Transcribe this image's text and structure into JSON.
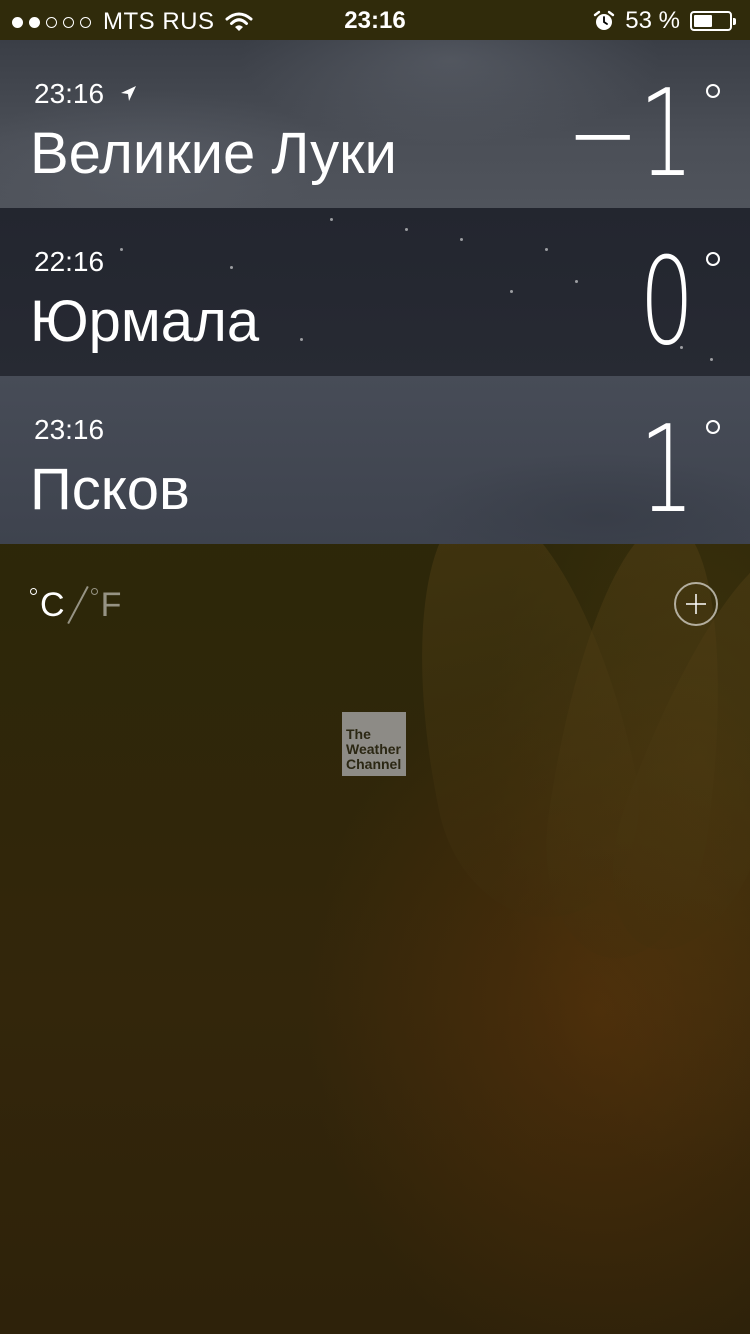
{
  "status_bar": {
    "signal_dots_filled": 2,
    "signal_dots_total": 5,
    "carrier": "MTS RUS",
    "time": "23:16",
    "battery_percent_text": "53 %",
    "battery_level": 0.53,
    "icons": [
      "signal-dots",
      "wifi-icon",
      "alarm-icon",
      "battery-icon"
    ]
  },
  "cities": [
    {
      "local_time": "23:16",
      "name": "Великие Луки",
      "temperature": "−1",
      "current_location": true,
      "icon": "location-arrow-icon"
    },
    {
      "local_time": "22:16",
      "name": "Юрмала",
      "temperature": "0",
      "current_location": false
    },
    {
      "local_time": "23:16",
      "name": "Псков",
      "temperature": "1",
      "current_location": false
    }
  ],
  "units": {
    "celsius": "C",
    "fahrenheit": "F",
    "selected": "celsius"
  },
  "add_button": {
    "icon": "plus-circle-icon"
  },
  "logo": {
    "line1": "The",
    "line2": "Weather",
    "line3": "Channel"
  },
  "colors": {
    "text": "#ffffff",
    "row_1_bg": "#474b53",
    "row_2_bg": "#252830",
    "row_3_bg": "#434853",
    "background": "#2e270b"
  }
}
